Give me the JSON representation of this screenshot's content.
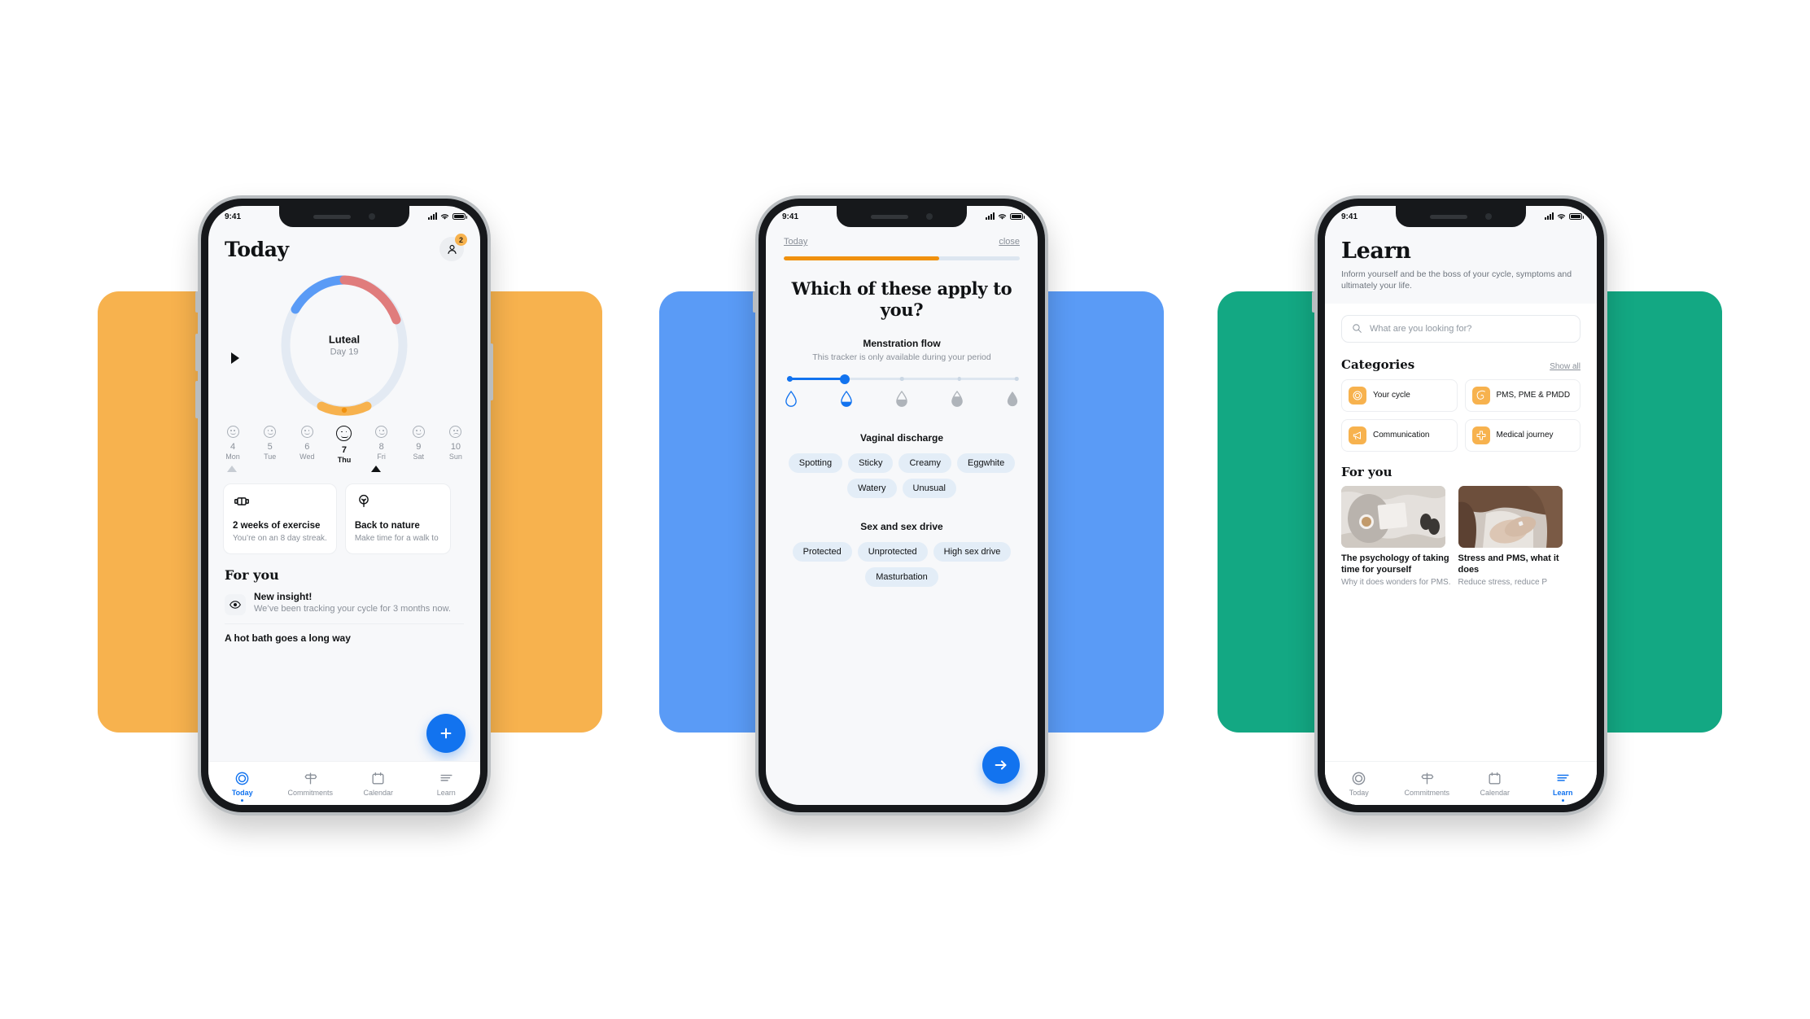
{
  "phones": [
    {
      "status_bar": {
        "time": "9:41"
      },
      "screen_name": "today",
      "header": {
        "title": "Today",
        "badge_count": "2"
      },
      "cycle_ring": {
        "phase": "Luteal",
        "day_label": "Day 19"
      },
      "week_strip": [
        {
          "num": "4",
          "weekday": "Mon",
          "mood": "smile",
          "selected": false
        },
        {
          "num": "5",
          "weekday": "Tue",
          "mood": "smile",
          "selected": false
        },
        {
          "num": "6",
          "weekday": "Wed",
          "mood": "smile",
          "selected": false
        },
        {
          "num": "7",
          "weekday": "Thu",
          "mood": "smile",
          "selected": true
        },
        {
          "num": "8",
          "weekday": "Fri",
          "mood": "smile",
          "selected": false
        },
        {
          "num": "9",
          "weekday": "Sat",
          "mood": "smile",
          "selected": false
        },
        {
          "num": "10",
          "weekday": "Sun",
          "mood": "frown",
          "selected": false
        }
      ],
      "commitment_cards": [
        {
          "icon": "dumbbell-icon",
          "title": "2 weeks of exercise",
          "subtitle": "You’re on an 8 day streak."
        },
        {
          "icon": "tree-icon",
          "title": "Back to nature",
          "subtitle": "Make time for a walk to"
        }
      ],
      "for_you": {
        "heading": "For you",
        "items": [
          {
            "icon": "eye-icon",
            "title": "New insight!",
            "subtitle": "We’ve been tracking your cycle for 3 months now."
          }
        ],
        "clipped_item": "A hot bath goes a long way"
      },
      "fab": {
        "icon": "plus-icon"
      },
      "tabbar": [
        {
          "label": "Today",
          "icon": "target-icon",
          "active": true
        },
        {
          "label": "Commitments",
          "icon": "signpost-icon",
          "active": false
        },
        {
          "label": "Calendar",
          "icon": "calendar-icon",
          "active": false
        },
        {
          "label": "Learn",
          "icon": "lines-icon",
          "active": false
        }
      ]
    },
    {
      "status_bar": {
        "time": "9:41"
      },
      "screen_name": "tracker-questionnaire",
      "top_bar": {
        "back_label": "Today",
        "close_label": "close"
      },
      "progress": {
        "percent": 66
      },
      "question": "Which of these apply to you?",
      "sections": [
        {
          "heading": "Menstration flow",
          "subheading": "This tracker is only available during your period",
          "type": "slider",
          "steps": 5,
          "selected_index": 1
        },
        {
          "heading": "Vaginal discharge",
          "type": "chips",
          "chips": [
            "Spotting",
            "Sticky",
            "Creamy",
            "Eggwhite",
            "Watery",
            "Unusual"
          ]
        },
        {
          "heading": "Sex and sex drive",
          "type": "chips",
          "chips": [
            "Protected",
            "Unprotected",
            "High sex drive",
            "Masturbation"
          ]
        }
      ],
      "next_button": {
        "icon": "arrow-right-icon"
      }
    },
    {
      "status_bar": {
        "time": "9:41"
      },
      "screen_name": "learn",
      "header": {
        "title": "Learn",
        "subtitle": "Inform yourself and be the boss of your cycle, symptoms and ultimately your life."
      },
      "search": {
        "placeholder": "What are you looking for?",
        "value": "",
        "icon": "search-icon"
      },
      "categories": {
        "heading": "Categories",
        "show_all": "Show all",
        "items": [
          {
            "label": "Your cycle",
            "icon": "target-icon"
          },
          {
            "label": "PMS, PME & PMDD",
            "icon": "spiral-icon"
          },
          {
            "label": "Communication",
            "icon": "megaphone-icon"
          },
          {
            "label": "Medical journey",
            "icon": "medical-cross-icon"
          }
        ]
      },
      "for_you": {
        "heading": "For you",
        "articles": [
          {
            "title": "The psychology of taking time for yourself",
            "subtitle": "Why it does wonders for PMS."
          },
          {
            "title": "Stress and PMS, what it does",
            "subtitle": "Reduce stress, reduce P"
          }
        ]
      },
      "tabbar": [
        {
          "label": "Today",
          "icon": "target-icon",
          "active": false
        },
        {
          "label": "Commitments",
          "icon": "signpost-icon",
          "active": false
        },
        {
          "label": "Calendar",
          "icon": "calendar-icon",
          "active": false
        },
        {
          "label": "Learn",
          "icon": "lines-icon",
          "active": true
        }
      ]
    }
  ],
  "colors": {
    "backdrop_1": "#F7B24E",
    "backdrop_2": "#5A9BF6",
    "backdrop_3": "#13A883",
    "accent_blue": "#1273EF",
    "accent_orange": "#F0910E",
    "ring_follicular": "#5A9BF6",
    "ring_ovulation": "#E07C7C",
    "ring_period": "#F7B24E",
    "ring_track": "#E3EAF3"
  }
}
